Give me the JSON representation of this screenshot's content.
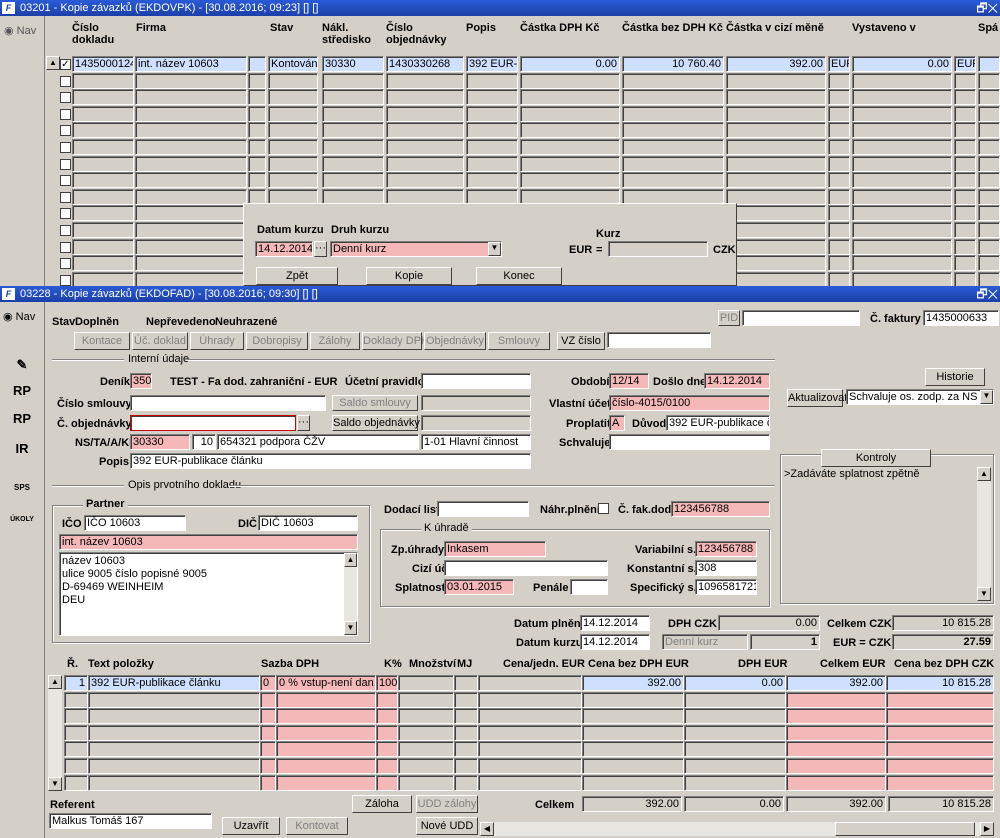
{
  "w1": {
    "title": "03201 - Kopie závazků (EKDOVPK) - [30.08.2016; 09:23] [] []",
    "nav": "Nav",
    "cols": [
      "Číslo dokladu",
      "Firma",
      "Stav",
      "Nákl. středisko",
      "Číslo objednávky",
      "Popis",
      "Částka DPH Kč",
      "Částka bez DPH Kč",
      "Částka v cizí měně",
      "Vystaveno v",
      "Spá"
    ],
    "row": {
      "doklad": "1435000124",
      "firma": "int. název 10603",
      "stav": "Kontován",
      "stredisko": "30330",
      "objednavka": "1430330268",
      "popis": "392 EUR-pu",
      "dph": "0.00",
      "bezdph": "10 760.40",
      "cizi": "392.00",
      "mena": "EUR",
      "vyst": "0.00",
      "mena2": "EUR"
    }
  },
  "popup": {
    "datum_lbl": "Datum kurzu",
    "druh_lbl": "Druh kurzu",
    "kurz_lbl": "Kurz",
    "datum": "14.12.2014",
    "druh": "Denní kurz",
    "eur": "EUR",
    "eq": "=",
    "czk": "CZK",
    "zpet": "Zpět",
    "kopie": "Kopie",
    "konec": "Konec"
  },
  "w2": {
    "title": "03228 - Kopie závazků (EKDOFAD) - [30.08.2016; 09:30] [] []",
    "nav": "Nav",
    "stav_lbl": "Stav",
    "stav": "Doplněn",
    "neprev": "Nepřevedeno",
    "neuhr": "Neuhrazené",
    "pid": "PID",
    "faktura_lbl": "Č. faktury",
    "faktura": "1435000633",
    "tabs": [
      "Kontace",
      "Úč. doklad",
      "Úhrady",
      "Dobropisy",
      "Zálohy",
      "Doklady DPH",
      "Objednávky",
      "Smlouvy"
    ],
    "vz": "VZ číslo",
    "interni": "Interní údaje",
    "denik_lbl": "Deník",
    "denik": "350",
    "denik_name": "TEST - Fa dod. zahraniční - EUR",
    "ucetni_lbl": "Účetní pravidlo",
    "obdobi_lbl": "Období",
    "obdobi": "12/14",
    "doslo_lbl": "Došlo dne",
    "doslo": "14.12.2014",
    "historie": "Historie",
    "smlouvy_lbl": "Číslo smlouvy",
    "saldo_sml": "Saldo smlouvy",
    "vlastni_lbl": "Vlastní účet",
    "vlastni": "číslo-4015/0100",
    "aktualizovat": "Aktualizovat",
    "schvaluje_sel": "Schvaluje os. zodp. za NS",
    "objedn_lbl": "Č. objednávky",
    "saldo_obj": "Saldo objednávky",
    "proplatit_lbl": "Proplatit",
    "proplatit": "A",
    "duvod_lbl": "Důvod",
    "duvod": "392 EUR-publikace článk",
    "ns_lbl": "NS/TA/A/KP",
    "ns": "30330",
    "ta": "10",
    "a": "654321 podpora ČŽV",
    "kp": "1-01 Hlavní činnost",
    "schvaluje_lbl": "Schvaluje",
    "popis_lbl": "Popis",
    "popis": "392 EUR-publikace článku",
    "kontroly": "Kontroly",
    "kontroly_text": ">Zadáváte splatnost zpětně",
    "opis": "Opis prvotního dokladu",
    "partner": "Partner",
    "ico_lbl": "IČO",
    "ico": "IČO 10603",
    "dic_lbl": "DIČ",
    "dic": "DIČ 10603",
    "partner_name": "int. název 10603",
    "adresa": [
      "název 10603",
      "ulice 9005 číslo popisné 9005",
      "D-69469 WEINHEIM",
      "DEU"
    ],
    "dodaci_lbl": "Dodací list",
    "nahr_lbl": "Náhr.plnění",
    "cfakdod_lbl": "Č. fak.dod",
    "cfakdod": "123456788",
    "kuhrade": "K úhradě",
    "zpuhr_lbl": "Zp.úhrady",
    "zpuhr": "Inkasem",
    "var_lbl": "Variabilní s.",
    "var": "123456788",
    "cizi_lbl": "Cizí účet",
    "konst_lbl": "Konstantní s.",
    "konst": "308",
    "splat_lbl": "Splatnost",
    "splat": "03.01.2015",
    "penale_lbl": "Penále",
    "spec_lbl": "Specifický s.",
    "spec": "1096581721",
    "dplneni_lbl": "Datum plnění",
    "dplneni": "14.12.2014",
    "dphczk_lbl": "DPH CZK",
    "dphczk": "0.00",
    "celkczk_lbl": "Celkem CZK",
    "celkczk": "10 815.28",
    "dkurzu_lbl": "Datum kurzu",
    "dkurzu": "14.12.2014",
    "druh": "Denní kurz",
    "kurz1": "1",
    "eurczk_lbl": "EUR = CZK",
    "eurczk": "27.59",
    "tcols": [
      "Ř.",
      "Text položky",
      "Sazba DPH",
      "K%",
      "Množství",
      "MJ",
      "Cena/jedn. EUR",
      "Cena bez DPH EUR",
      "DPH EUR",
      "Celkem EUR",
      "Cena bez DPH CZK"
    ],
    "trow": {
      "r": "1",
      "text": "392 EUR-publikace článku",
      "sazba": "0",
      "sazbatext": "0 % vstup-není dan. d",
      "k": "100",
      "bez": "392.00",
      "dph": "0.00",
      "celk": "392.00",
      "czk": "10 815.28"
    },
    "referent_lbl": "Referent",
    "referent": "Malkus Tomáš 167",
    "uzavrit": "Uzavřít",
    "kontovat": "Kontovat",
    "zaloha": "Záloha",
    "udd_zal": "UDD zálohy",
    "nove_udd": "Nové UDD",
    "celkem_lbl": "Celkem",
    "sum_bez": "392.00",
    "sum_dph": "0.00",
    "sum_celk": "392.00",
    "sum_czk": "10 815.28",
    "side": [
      "RP",
      "RP",
      "IR",
      "SPS",
      "ÚKOLY"
    ]
  }
}
